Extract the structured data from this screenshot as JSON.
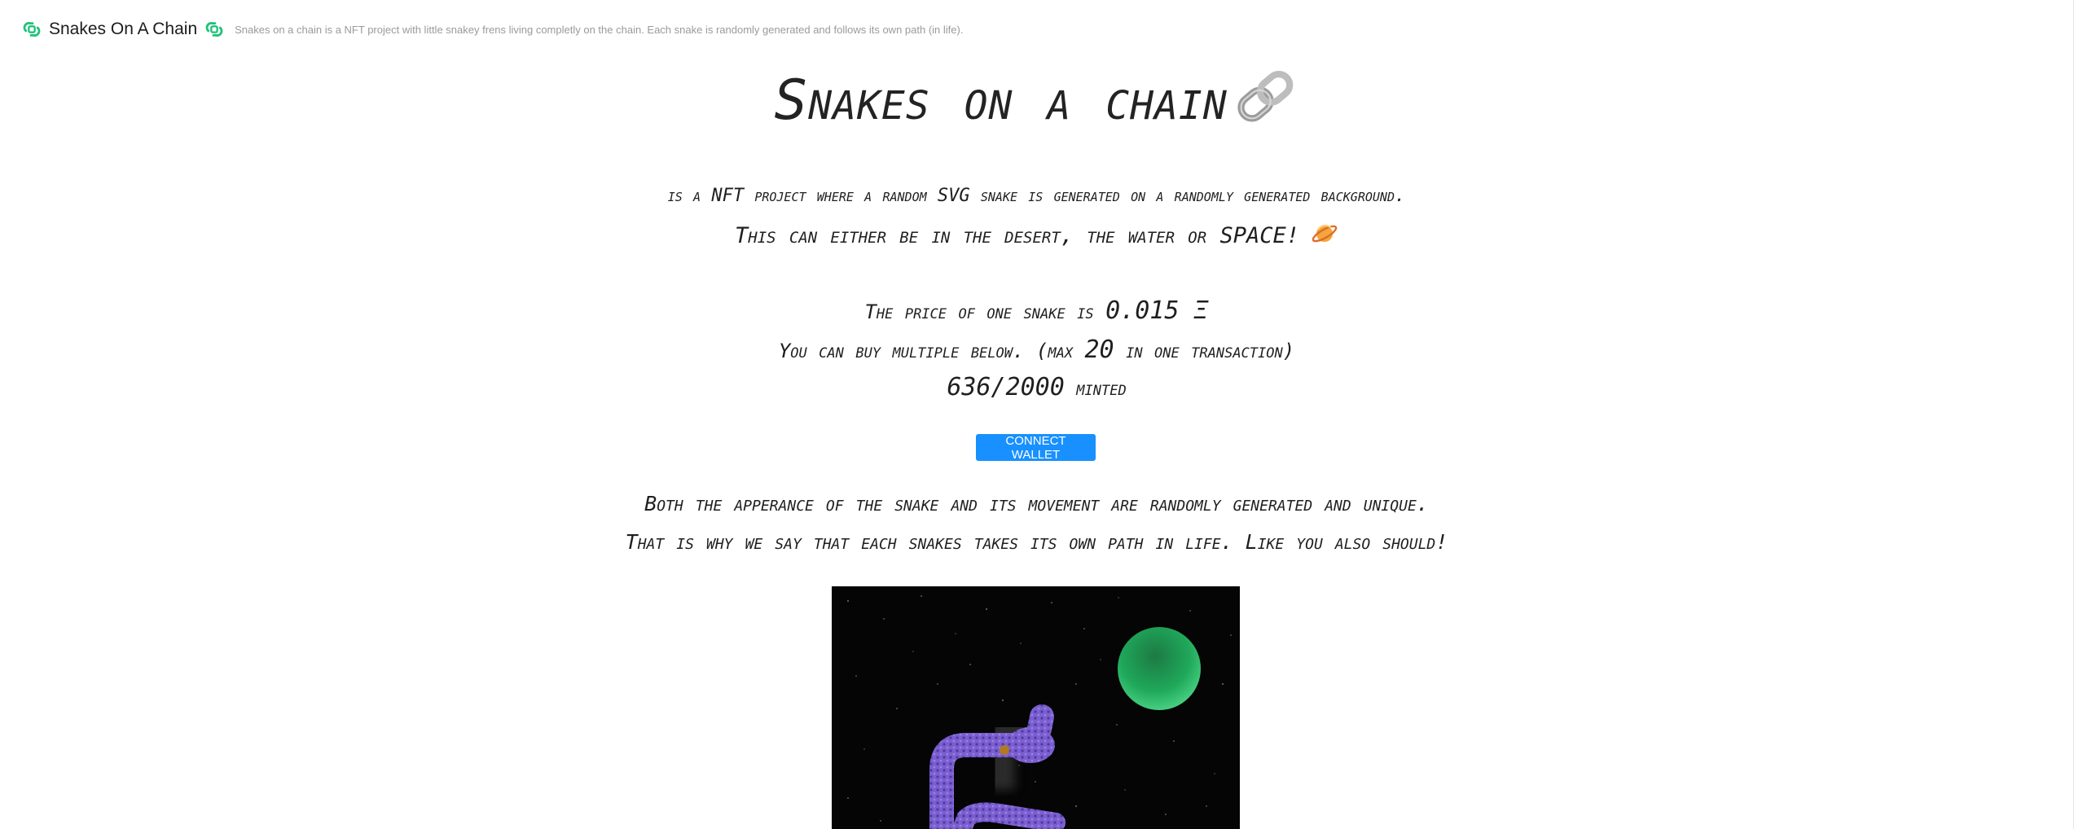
{
  "header": {
    "brand": "Snakes On A Chain",
    "tagline": "Snakes on a chain is a NFT project with little snakey frens living completly on the chain. Each snake is randomly generated and follows its own path (in life)."
  },
  "hero": {
    "title": "Snakes on a chain",
    "chain_icon": "link-emoji"
  },
  "intro": {
    "line1": "is a NFT project where a random SVG snake is generated on a randomly generated background.",
    "line2": "This can either be in the desert, the water or SPACE!",
    "planet_icon": "ringed-planet-emoji"
  },
  "pricing": {
    "price_prefix": "The price of one snake is",
    "price_value": "0.015 Ξ",
    "buy_prefix": "You can buy multiple below. (max",
    "max_value": "20",
    "buy_suffix": "in one transaction)",
    "minted_count": "636/2000",
    "minted_label": "minted"
  },
  "connect_button": "CONNECT WALLET",
  "description": {
    "line1": "Both the apperance of the snake and its movement are randomly generated and unique.",
    "line2": "That is why we say that each snakes takes its own path in life. Like you also should!"
  },
  "colors": {
    "brand_green": "#21c27a",
    "button_blue": "#1890ff",
    "snake_purple": "#7b5fd0",
    "planet_green": "#1fa85a",
    "space_black": "#050505"
  }
}
